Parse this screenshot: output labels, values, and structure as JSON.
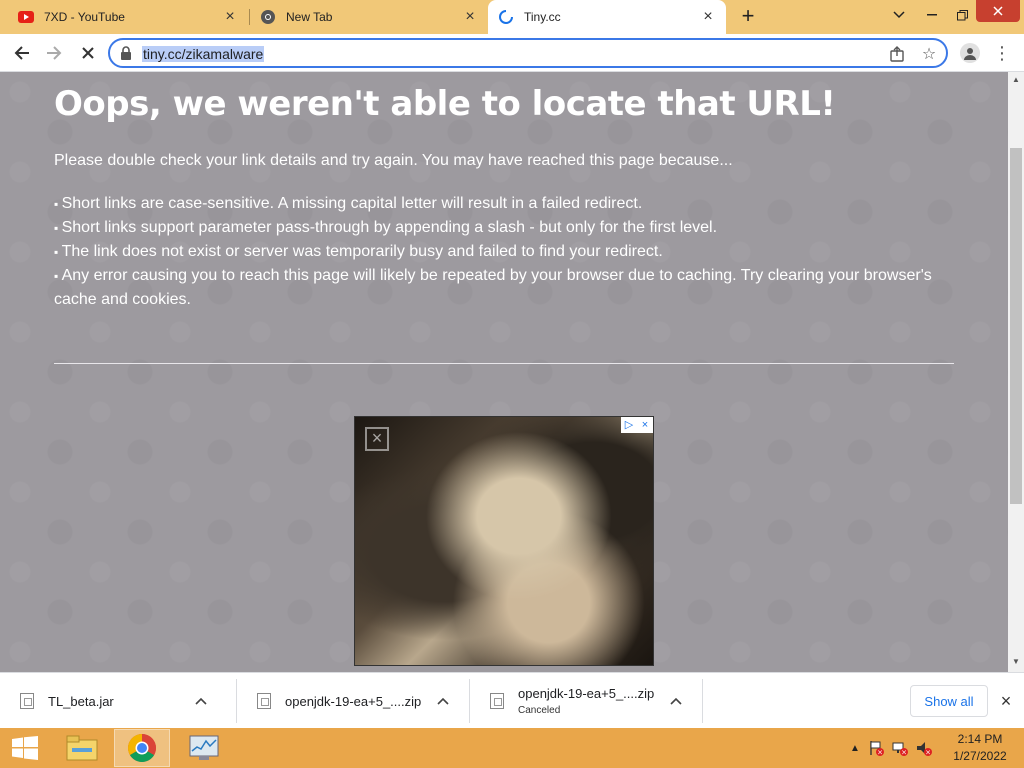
{
  "tabs": [
    {
      "title": "7XD - YouTube",
      "icon": "youtube-icon"
    },
    {
      "title": "New Tab",
      "icon": "chrome-icon"
    },
    {
      "title": "Tiny.cc",
      "icon": "loading-spinner-icon"
    }
  ],
  "toolbar": {
    "url": "tiny.cc/zikamalware"
  },
  "page": {
    "heading": "Oops, we weren't able to locate that URL!",
    "intro": "Please double check your link details and try again. You may have reached this page because...",
    "reasons": [
      "Short links are case-sensitive. A missing capital letter will result in a failed redirect.",
      "Short links support parameter pass-through by appending a slash - but only for the first level.",
      "The link does not exist or server was temporarily busy and failed to find your redirect.",
      "Any error causing you to reach this page will likely be repeated by your browser due to caching. Try clearing your browser's cache and cookies."
    ]
  },
  "downloads": {
    "items": [
      {
        "name": "TL_beta.jar",
        "status": ""
      },
      {
        "name": "openjdk-19-ea+5_....zip",
        "status": ""
      },
      {
        "name": "openjdk-19-ea+5_....zip",
        "status": "Canceled"
      }
    ],
    "show_all": "Show all"
  },
  "taskbar": {
    "time": "2:14 PM",
    "date": "1/27/2022"
  },
  "colors": {
    "accent": "#3b78e7",
    "titlebar": "#f1c878",
    "taskbar": "#e9a64a",
    "page_bg": "#9d9a9f"
  }
}
